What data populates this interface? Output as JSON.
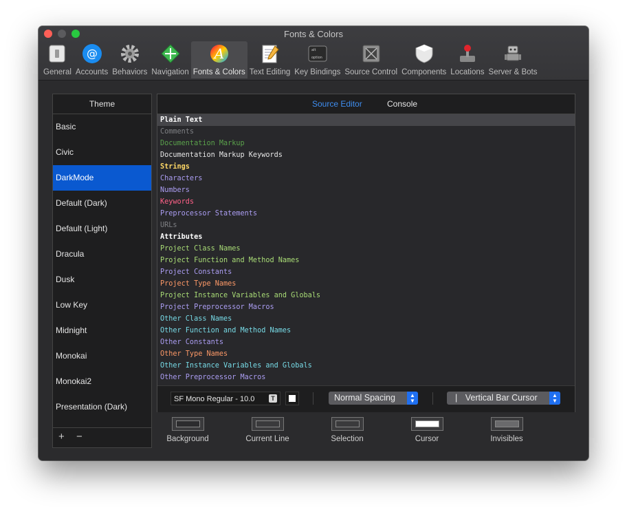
{
  "window": {
    "title": "Fonts & Colors"
  },
  "toolbar": {
    "items": [
      {
        "label": "General",
        "icon": "general-switch-icon"
      },
      {
        "label": "Accounts",
        "icon": "at-sign-icon"
      },
      {
        "label": "Behaviors",
        "icon": "gear-icon"
      },
      {
        "label": "Navigation",
        "icon": "navigation-arrows-icon"
      },
      {
        "label": "Fonts & Colors",
        "icon": "font-a-icon",
        "selected": true
      },
      {
        "label": "Text Editing",
        "icon": "notepad-pencil-icon"
      },
      {
        "label": "Key Bindings",
        "icon": "option-key-icon"
      },
      {
        "label": "Source Control",
        "icon": "source-control-box-icon"
      },
      {
        "label": "Components",
        "icon": "shield-icon"
      },
      {
        "label": "Locations",
        "icon": "joystick-icon"
      },
      {
        "label": "Server & Bots",
        "icon": "robot-icon"
      }
    ]
  },
  "sidebar": {
    "header": "Theme",
    "items": [
      {
        "label": "Basic"
      },
      {
        "label": "Civic"
      },
      {
        "label": "DarkMode",
        "selected": true
      },
      {
        "label": "Default (Dark)"
      },
      {
        "label": "Default (Light)"
      },
      {
        "label": "Dracula"
      },
      {
        "label": "Dusk"
      },
      {
        "label": "Low Key"
      },
      {
        "label": "Midnight"
      },
      {
        "label": "Monokai"
      },
      {
        "label": "Monokai2"
      },
      {
        "label": "Presentation (Dark)"
      }
    ],
    "add_label": "+",
    "remove_label": "−"
  },
  "editor": {
    "tabs": {
      "source_editor": "Source Editor",
      "console": "Console"
    },
    "rows": [
      {
        "label": "Plain Text",
        "color": "#ffffff",
        "selected": true,
        "bold": true
      },
      {
        "label": "Comments",
        "color": "#7f8084"
      },
      {
        "label": "Documentation Markup",
        "color": "#5aa14b"
      },
      {
        "label": "Documentation Markup Keywords",
        "color": "#e6e6e6"
      },
      {
        "label": "Strings",
        "color": "#ffd866",
        "bold": true
      },
      {
        "label": "Characters",
        "color": "#ab9df2"
      },
      {
        "label": "Numbers",
        "color": "#ab9df2"
      },
      {
        "label": "Keywords",
        "color": "#ff6188"
      },
      {
        "label": "Preprocessor Statements",
        "color": "#ab9df2"
      },
      {
        "label": "URLs",
        "color": "#7f8084"
      },
      {
        "label": "Attributes",
        "color": "#ffffff",
        "bold": true
      },
      {
        "label": "Project Class Names",
        "color": "#a9dc76"
      },
      {
        "label": "Project Function and Method Names",
        "color": "#a9dc76"
      },
      {
        "label": "Project Constants",
        "color": "#ab9df2"
      },
      {
        "label": "Project Type Names",
        "color": "#fc9867"
      },
      {
        "label": "Project Instance Variables and Globals",
        "color": "#a9dc76"
      },
      {
        "label": "Project Preprocessor Macros",
        "color": "#ab9df2"
      },
      {
        "label": "Other Class Names",
        "color": "#78dce8"
      },
      {
        "label": "Other Function and Method Names",
        "color": "#78dce8"
      },
      {
        "label": "Other Constants",
        "color": "#ab9df2"
      },
      {
        "label": "Other Type Names",
        "color": "#fc9867"
      },
      {
        "label": "Other Instance Variables and Globals",
        "color": "#78dce8"
      },
      {
        "label": "Other Preprocessor Macros",
        "color": "#ab9df2"
      }
    ],
    "font_value": "SF Mono Regular - 10.0",
    "font_button": "T",
    "spacing_value": "Normal Spacing",
    "cursor_prefix": "|",
    "cursor_value": "Vertical Bar Cursor"
  },
  "swatches": [
    {
      "label": "Background",
      "fill": "#2c2c2e"
    },
    {
      "label": "Current Line",
      "fill": "#3a3a3c"
    },
    {
      "label": "Selection",
      "fill": "#3a3a3c"
    },
    {
      "label": "Cursor",
      "fill": "#ffffff"
    },
    {
      "label": "Invisibles",
      "fill": "#6a6a6c"
    }
  ]
}
